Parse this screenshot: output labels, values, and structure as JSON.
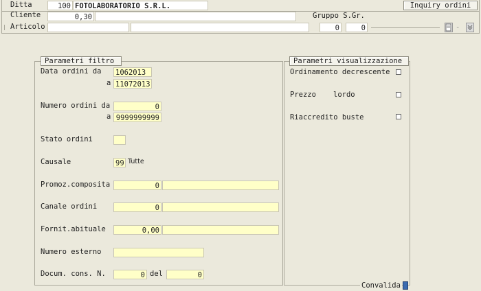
{
  "header": {
    "ditta": {
      "label": "Ditta",
      "code": "100",
      "name": "FOTOLABORATORIO S.R.L."
    },
    "cliente": {
      "label": "Cliente",
      "value": "0,30",
      "name": ""
    },
    "articolo": {
      "label": "Articolo",
      "code": "",
      "desc": ""
    },
    "gruppo": {
      "label": "Gruppo S.Gr.",
      "gruppo": "0",
      "sgruppo": "0"
    },
    "inquiry_button": "Inquiry ordini"
  },
  "filter": {
    "title": "Parametri filtro",
    "data_label": "Data   ordini da",
    "data_da": "1062013",
    "a_label": "a",
    "data_a": "11072013",
    "numero_label": "Numero ordini da",
    "numero_da": "0",
    "numero_a": "9999999999",
    "stato_label": "Stato ordini",
    "stato_value": "",
    "causale_label": "Causale",
    "causale_code": "99",
    "causale_desc": "Tutte",
    "promoz_label": "Promoz.composita",
    "promoz_value": "0",
    "promoz_desc": "",
    "canale_label": "Canale ordini",
    "canale_value": "0",
    "canale_desc": "",
    "fornit_label": "Fornit.abituale",
    "fornit_value": "0,00",
    "fornit_desc": "",
    "numero_esterno_label": "Numero esterno",
    "numero_esterno_value": "",
    "docum_label": "Docum. cons. N.",
    "docum_value": "0",
    "del_label": "del",
    "del_value": "0"
  },
  "display": {
    "title": "Parametri visualizzazione",
    "ordinamento": "Ordinamento decrescente",
    "prezzo": "Prezzo",
    "lordo": "lordo",
    "riaccredito": "Riaccredito buste"
  },
  "footer": {
    "convalida": "Convalida"
  }
}
